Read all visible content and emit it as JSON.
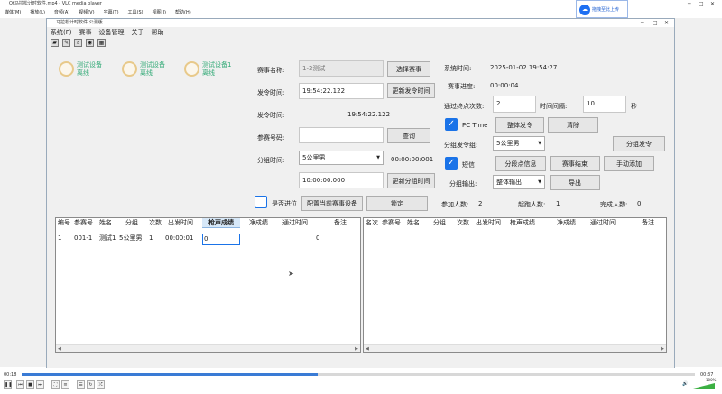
{
  "vlc": {
    "title": "Qt马拉松计时软件.mp4 - VLC media player",
    "menu": [
      "媒体(M)",
      "播放(L)",
      "音频(A)",
      "视频(V)",
      "字幕(T)",
      "工具(S)",
      "视图(I)",
      "帮助(H)"
    ],
    "elapsed": "00:18",
    "total": "00:37",
    "volume": "100%",
    "progress": 0.44,
    "window_controls": [
      "─",
      "□",
      "✕"
    ]
  },
  "upload_badge": {
    "label": "拖拽至此上传",
    "icon": "cloud-upload-icon"
  },
  "app": {
    "title": "马拉松计时软件 公测版",
    "window_controls": [
      "─",
      "□",
      "✕"
    ],
    "menu": [
      "系统(F)",
      "赛事",
      "设备管理",
      "关于",
      "帮助"
    ],
    "toolbar": [
      "open-icon",
      "edit-icon",
      "search-icon",
      "record-icon",
      "qr-icon"
    ],
    "devices": [
      {
        "name": "测试设备",
        "status": "离线"
      },
      {
        "name": "测试设备",
        "status": "离线"
      },
      {
        "name": "测试设备1",
        "status": "离线"
      }
    ],
    "form": {
      "event_name_label": "赛事名称:",
      "event_name_value": "1-2测试",
      "select_event_btn": "选择赛事",
      "start_time_label": "发令时间:",
      "start_time_value": "19:54:22.122",
      "update_start_btn": "更新发令时间",
      "start_time2_label": "发令时间:",
      "start_time2_value": "19:54:22.122",
      "athlete_no_label": "参赛号码:",
      "athlete_no_value": "",
      "query_btn": "查询",
      "group_time_label": "分组时间:",
      "group_select": "5公里男",
      "group_elapsed": "00:00:00:001",
      "group_time_value": "10:00:00.000",
      "update_group_btn": "更新分组时间",
      "promote_label": "是否进位",
      "promote_checked": false,
      "config_btn": "配置当前赛事设备",
      "lock_btn": "锁定"
    },
    "status": {
      "sys_time_label": "系统时间:",
      "sys_time_value": "2025-01-02 19:54:27",
      "progress_label": "赛事进度:",
      "progress_value": "00:00:04",
      "pass_count_label": "通过终点次数:",
      "pass_count_value": "2",
      "interval_label": "时间间隔:",
      "interval_value": "10",
      "interval_unit": "秒",
      "pc_time_label": "PC Time",
      "pc_time_checked": true,
      "whole_start_btn": "整体发令",
      "clear_btn": "清除",
      "group_start_label": "分组发令组:",
      "group_start_select": "5公里男",
      "group_start_btn": "分组发令",
      "sms_label": "短信",
      "sms_checked": true,
      "split_info_btn": "分段点信息",
      "event_end_btn": "赛事结束",
      "manual_add_btn": "手动添加",
      "group_output_label": "分组输出:",
      "group_output_select": "整体输出",
      "export_btn": "导出",
      "participants_label": "参加人数:",
      "participants_value": "2",
      "starters_label": "起跑人数:",
      "starters_value": "1",
      "finishers_label": "完成人数:",
      "finishers_value": "0"
    },
    "left_table": {
      "headers": [
        "编号",
        "参赛号",
        "姓名",
        "分组",
        "次数",
        "出发时间",
        "枪声成绩",
        "净成绩",
        "通过时间",
        "备注"
      ],
      "rows": [
        [
          "1",
          "001-1",
          "测试1",
          "5公里男",
          "1",
          "00:00:01",
          "0",
          "",
          "",
          "0"
        ]
      ]
    },
    "right_table": {
      "headers": [
        "名次",
        "参赛号",
        "姓名",
        "分组",
        "次数",
        "出发时间",
        "枪声成绩",
        "净成绩",
        "通过时间",
        "备注"
      ]
    }
  }
}
